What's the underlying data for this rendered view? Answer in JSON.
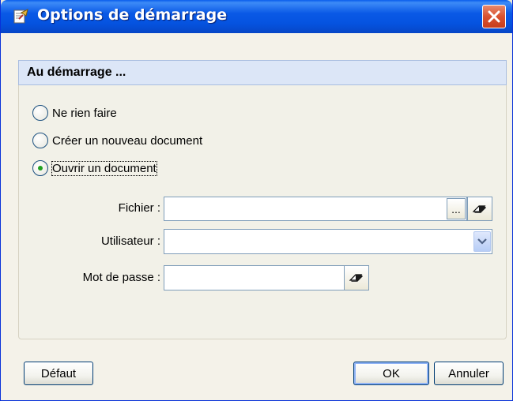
{
  "window": {
    "title": "Options de démarrage"
  },
  "group": {
    "header": "Au démarrage ..."
  },
  "options": [
    {
      "label": "Ne rien faire",
      "selected": false
    },
    {
      "label": "Créer un nouveau document",
      "selected": false
    },
    {
      "label": "Ouvrir un document",
      "selected": true
    }
  ],
  "fields": {
    "fichier": {
      "label": "Fichier :",
      "value": "",
      "browse_label": "..."
    },
    "utilisateur": {
      "label": "Utilisateur :",
      "value": ""
    },
    "mot_de_passe": {
      "label": "Mot de passe :",
      "value": ""
    }
  },
  "buttons": {
    "defaut": "Défaut",
    "ok": "OK",
    "annuler": "Annuler"
  },
  "icons": {
    "title": "options-app-icon",
    "close": "close-icon",
    "eraser": "eraser-icon",
    "dropdown": "chevron-down-icon"
  },
  "colors": {
    "titlebar": "#0553e0",
    "close": "#d95230",
    "group_header": "#dce6f7",
    "radio_dot": "#21a121"
  }
}
